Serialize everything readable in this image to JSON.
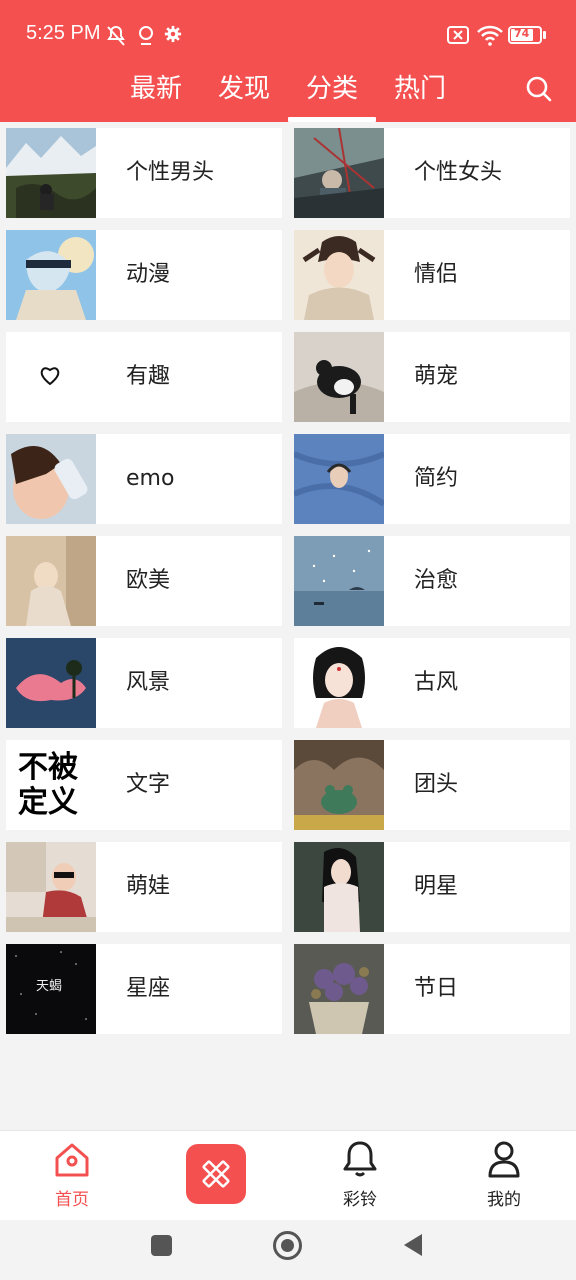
{
  "status_bar": {
    "time": "5:25 PM",
    "battery": "74"
  },
  "tabs": [
    {
      "label": "最新"
    },
    {
      "label": "发现"
    },
    {
      "label": "分类"
    },
    {
      "label": "热门"
    }
  ],
  "active_tab": "分类",
  "categories": [
    {
      "label": "个性男头",
      "thumb": "mountain-camp-photo"
    },
    {
      "label": "个性女头",
      "thumb": "ferris-wheel-photo"
    },
    {
      "label": "动漫",
      "thumb": "anime-boy-sky"
    },
    {
      "label": "情侣",
      "thumb": "anime-boy-sketch"
    },
    {
      "label": "有趣",
      "thumb": "heart-doodle"
    },
    {
      "label": "萌宠",
      "thumb": "cat-on-bed-photo"
    },
    {
      "label": "emo",
      "thumb": "girl-drinking-photo"
    },
    {
      "label": "简约",
      "thumb": "blue-fabric-face"
    },
    {
      "label": "欧美",
      "thumb": "vintage-woman-photo"
    },
    {
      "label": "治愈",
      "thumb": "night-sea-boat"
    },
    {
      "label": "风景",
      "thumb": "pink-cloud-tree"
    },
    {
      "label": "古风",
      "thumb": "ancient-girl-illustration"
    },
    {
      "label": "文字",
      "thumb": "text-image",
      "thumb_text": "不被\n定义"
    },
    {
      "label": "团头",
      "thumb": "frog-figure-photo"
    },
    {
      "label": "萌娃",
      "thumb": "child-sunglasses-photo"
    },
    {
      "label": "明星",
      "thumb": "star-woman-photo"
    },
    {
      "label": "星座",
      "thumb": "starry-night-text",
      "thumb_text": "天蝎"
    },
    {
      "label": "节日",
      "thumb": "flower-bouquet-photo"
    }
  ],
  "bottom_nav": [
    {
      "label": "首页",
      "icon": "home-icon"
    },
    {
      "label": "",
      "icon": "pencil-ruler-icon"
    },
    {
      "label": "彩铃",
      "icon": "bell-icon"
    },
    {
      "label": "我的",
      "icon": "user-icon"
    }
  ],
  "colors": {
    "accent": "#f45050",
    "background": "#f3f3f3",
    "card": "#ffffff"
  }
}
